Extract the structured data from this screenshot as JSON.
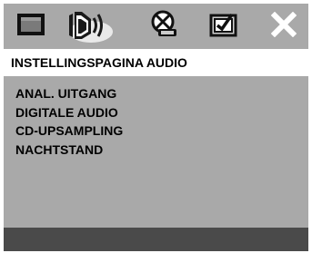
{
  "tabs": [
    {
      "icon": "general-setup-icon",
      "selected": false
    },
    {
      "icon": "audio-speaker-icon",
      "selected": true
    },
    {
      "icon": "dolby-decoder-icon",
      "selected": false
    },
    {
      "icon": "preferences-check-icon",
      "selected": false
    },
    {
      "icon": "exit-close-icon",
      "selected": false
    }
  ],
  "page": {
    "title": "INSTELLINGSPAGINA AUDIO"
  },
  "menu": {
    "items": [
      {
        "label": "ANAL. UITGANG"
      },
      {
        "label": "DIGITALE AUDIO"
      },
      {
        "label": "CD-UPSAMPLING"
      },
      {
        "label": "NACHTSTAND"
      }
    ]
  },
  "colors": {
    "panel": "#a9a9a9",
    "title_bar": "#ffffff",
    "bottom_bar": "#4a4a4a",
    "text": "#000000"
  }
}
